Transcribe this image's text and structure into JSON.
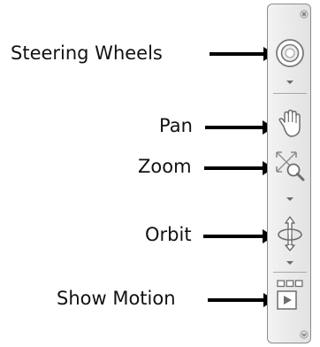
{
  "callouts": {
    "steering_wheels": "Steering Wheels",
    "pan": "Pan",
    "zoom": "Zoom",
    "orbit": "Orbit",
    "show_motion": "Show Motion"
  },
  "navbar": {
    "tools": [
      {
        "name": "steering-wheels",
        "icon": "steering-wheel-icon",
        "has_dropdown": true
      },
      {
        "name": "pan",
        "icon": "hand-icon",
        "has_dropdown": false
      },
      {
        "name": "zoom",
        "icon": "zoom-magnifier-icon",
        "has_dropdown": true
      },
      {
        "name": "orbit",
        "icon": "orbit-icon",
        "has_dropdown": true
      },
      {
        "name": "show-motion",
        "icon": "show-motion-icon",
        "has_dropdown": false
      }
    ],
    "colors": {
      "bar_light": "#f3f3f3",
      "bar_dark": "#e2e2e2",
      "border": "#8c8c8c",
      "icon_stroke": "#6e6e6e"
    }
  }
}
